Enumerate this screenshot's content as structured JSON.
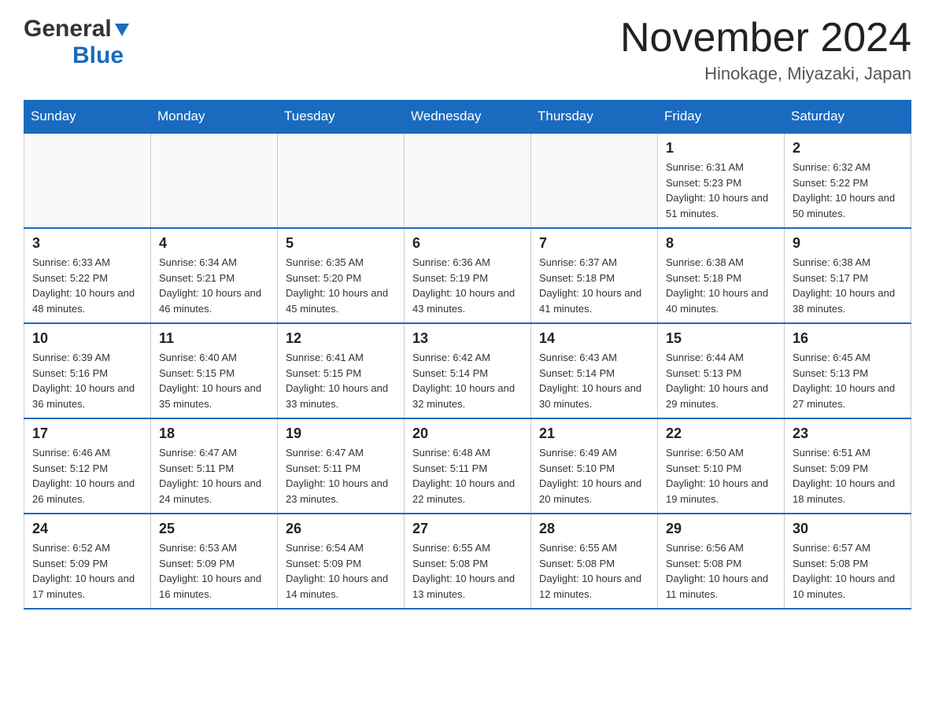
{
  "header": {
    "logo_general": "General",
    "logo_blue": "Blue",
    "month_title": "November 2024",
    "location": "Hinokage, Miyazaki, Japan"
  },
  "weekdays": [
    "Sunday",
    "Monday",
    "Tuesday",
    "Wednesday",
    "Thursday",
    "Friday",
    "Saturday"
  ],
  "weeks": [
    [
      {
        "day": "",
        "sunrise": "",
        "sunset": "",
        "daylight": ""
      },
      {
        "day": "",
        "sunrise": "",
        "sunset": "",
        "daylight": ""
      },
      {
        "day": "",
        "sunrise": "",
        "sunset": "",
        "daylight": ""
      },
      {
        "day": "",
        "sunrise": "",
        "sunset": "",
        "daylight": ""
      },
      {
        "day": "",
        "sunrise": "",
        "sunset": "",
        "daylight": ""
      },
      {
        "day": "1",
        "sunrise": "Sunrise: 6:31 AM",
        "sunset": "Sunset: 5:23 PM",
        "daylight": "Daylight: 10 hours and 51 minutes."
      },
      {
        "day": "2",
        "sunrise": "Sunrise: 6:32 AM",
        "sunset": "Sunset: 5:22 PM",
        "daylight": "Daylight: 10 hours and 50 minutes."
      }
    ],
    [
      {
        "day": "3",
        "sunrise": "Sunrise: 6:33 AM",
        "sunset": "Sunset: 5:22 PM",
        "daylight": "Daylight: 10 hours and 48 minutes."
      },
      {
        "day": "4",
        "sunrise": "Sunrise: 6:34 AM",
        "sunset": "Sunset: 5:21 PM",
        "daylight": "Daylight: 10 hours and 46 minutes."
      },
      {
        "day": "5",
        "sunrise": "Sunrise: 6:35 AM",
        "sunset": "Sunset: 5:20 PM",
        "daylight": "Daylight: 10 hours and 45 minutes."
      },
      {
        "day": "6",
        "sunrise": "Sunrise: 6:36 AM",
        "sunset": "Sunset: 5:19 PM",
        "daylight": "Daylight: 10 hours and 43 minutes."
      },
      {
        "day": "7",
        "sunrise": "Sunrise: 6:37 AM",
        "sunset": "Sunset: 5:18 PM",
        "daylight": "Daylight: 10 hours and 41 minutes."
      },
      {
        "day": "8",
        "sunrise": "Sunrise: 6:38 AM",
        "sunset": "Sunset: 5:18 PM",
        "daylight": "Daylight: 10 hours and 40 minutes."
      },
      {
        "day": "9",
        "sunrise": "Sunrise: 6:38 AM",
        "sunset": "Sunset: 5:17 PM",
        "daylight": "Daylight: 10 hours and 38 minutes."
      }
    ],
    [
      {
        "day": "10",
        "sunrise": "Sunrise: 6:39 AM",
        "sunset": "Sunset: 5:16 PM",
        "daylight": "Daylight: 10 hours and 36 minutes."
      },
      {
        "day": "11",
        "sunrise": "Sunrise: 6:40 AM",
        "sunset": "Sunset: 5:15 PM",
        "daylight": "Daylight: 10 hours and 35 minutes."
      },
      {
        "day": "12",
        "sunrise": "Sunrise: 6:41 AM",
        "sunset": "Sunset: 5:15 PM",
        "daylight": "Daylight: 10 hours and 33 minutes."
      },
      {
        "day": "13",
        "sunrise": "Sunrise: 6:42 AM",
        "sunset": "Sunset: 5:14 PM",
        "daylight": "Daylight: 10 hours and 32 minutes."
      },
      {
        "day": "14",
        "sunrise": "Sunrise: 6:43 AM",
        "sunset": "Sunset: 5:14 PM",
        "daylight": "Daylight: 10 hours and 30 minutes."
      },
      {
        "day": "15",
        "sunrise": "Sunrise: 6:44 AM",
        "sunset": "Sunset: 5:13 PM",
        "daylight": "Daylight: 10 hours and 29 minutes."
      },
      {
        "day": "16",
        "sunrise": "Sunrise: 6:45 AM",
        "sunset": "Sunset: 5:13 PM",
        "daylight": "Daylight: 10 hours and 27 minutes."
      }
    ],
    [
      {
        "day": "17",
        "sunrise": "Sunrise: 6:46 AM",
        "sunset": "Sunset: 5:12 PM",
        "daylight": "Daylight: 10 hours and 26 minutes."
      },
      {
        "day": "18",
        "sunrise": "Sunrise: 6:47 AM",
        "sunset": "Sunset: 5:11 PM",
        "daylight": "Daylight: 10 hours and 24 minutes."
      },
      {
        "day": "19",
        "sunrise": "Sunrise: 6:47 AM",
        "sunset": "Sunset: 5:11 PM",
        "daylight": "Daylight: 10 hours and 23 minutes."
      },
      {
        "day": "20",
        "sunrise": "Sunrise: 6:48 AM",
        "sunset": "Sunset: 5:11 PM",
        "daylight": "Daylight: 10 hours and 22 minutes."
      },
      {
        "day": "21",
        "sunrise": "Sunrise: 6:49 AM",
        "sunset": "Sunset: 5:10 PM",
        "daylight": "Daylight: 10 hours and 20 minutes."
      },
      {
        "day": "22",
        "sunrise": "Sunrise: 6:50 AM",
        "sunset": "Sunset: 5:10 PM",
        "daylight": "Daylight: 10 hours and 19 minutes."
      },
      {
        "day": "23",
        "sunrise": "Sunrise: 6:51 AM",
        "sunset": "Sunset: 5:09 PM",
        "daylight": "Daylight: 10 hours and 18 minutes."
      }
    ],
    [
      {
        "day": "24",
        "sunrise": "Sunrise: 6:52 AM",
        "sunset": "Sunset: 5:09 PM",
        "daylight": "Daylight: 10 hours and 17 minutes."
      },
      {
        "day": "25",
        "sunrise": "Sunrise: 6:53 AM",
        "sunset": "Sunset: 5:09 PM",
        "daylight": "Daylight: 10 hours and 16 minutes."
      },
      {
        "day": "26",
        "sunrise": "Sunrise: 6:54 AM",
        "sunset": "Sunset: 5:09 PM",
        "daylight": "Daylight: 10 hours and 14 minutes."
      },
      {
        "day": "27",
        "sunrise": "Sunrise: 6:55 AM",
        "sunset": "Sunset: 5:08 PM",
        "daylight": "Daylight: 10 hours and 13 minutes."
      },
      {
        "day": "28",
        "sunrise": "Sunrise: 6:55 AM",
        "sunset": "Sunset: 5:08 PM",
        "daylight": "Daylight: 10 hours and 12 minutes."
      },
      {
        "day": "29",
        "sunrise": "Sunrise: 6:56 AM",
        "sunset": "Sunset: 5:08 PM",
        "daylight": "Daylight: 10 hours and 11 minutes."
      },
      {
        "day": "30",
        "sunrise": "Sunrise: 6:57 AM",
        "sunset": "Sunset: 5:08 PM",
        "daylight": "Daylight: 10 hours and 10 minutes."
      }
    ]
  ]
}
